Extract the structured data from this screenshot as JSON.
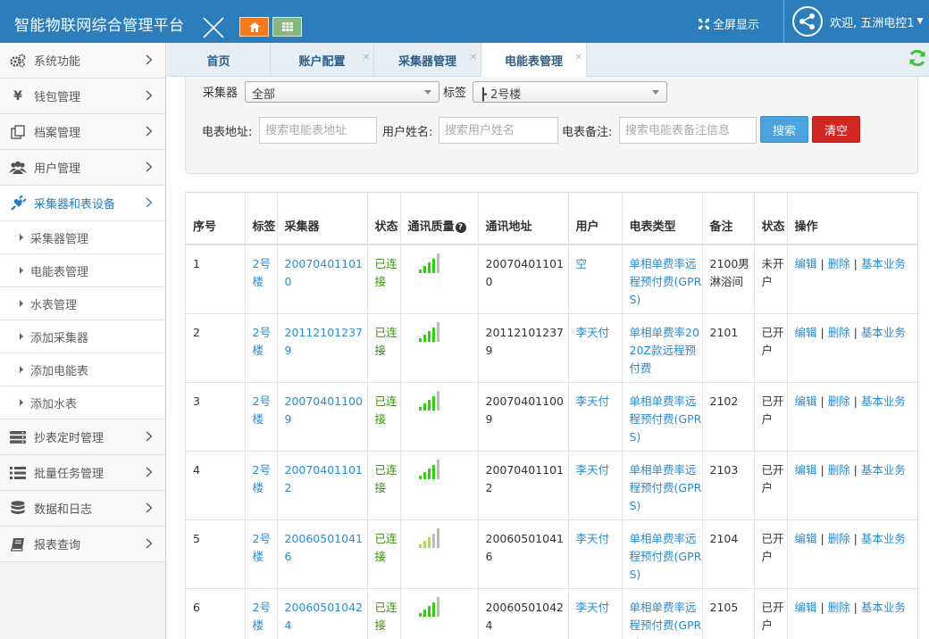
{
  "header": {
    "title": "智能物联网综合管理平台",
    "fullscreen": "全屏显示",
    "welcome": "欢迎, 五洲电控1"
  },
  "sidebar": {
    "items": [
      {
        "label": "系统功能",
        "icon": "cogs-icon"
      },
      {
        "label": "钱包管理",
        "icon": "yen-icon"
      },
      {
        "label": "档案管理",
        "icon": "archive-icon"
      },
      {
        "label": "用户管理",
        "icon": "users-icon"
      },
      {
        "label": "采集器和表设备",
        "icon": "plug-icon"
      }
    ],
    "subitems": [
      "采集器管理",
      "电能表管理",
      "水表管理",
      "添加采集器",
      "添加电能表",
      "添加水表"
    ],
    "items_after": [
      {
        "label": "抄表定时管理",
        "icon": "timer-icon"
      },
      {
        "label": "批量任务管理",
        "icon": "list-icon"
      },
      {
        "label": "数据和日志",
        "icon": "database-icon"
      },
      {
        "label": "报表查询",
        "icon": "book-icon"
      }
    ]
  },
  "tabs": [
    {
      "label": "首页"
    },
    {
      "label": "账户配置"
    },
    {
      "label": "采集器管理"
    },
    {
      "label": "电能表管理"
    }
  ],
  "filter": {
    "collector_label": "采集器",
    "collector_value": "全部",
    "tag_label": "标签",
    "tag_value": "┣ 2号楼",
    "meter_addr_label": "电表地址:",
    "meter_addr_placeholder": "搜索电能表地址",
    "user_label": "用户姓名:",
    "user_placeholder": "搜索用户姓名",
    "note_label": "电表备注:",
    "note_placeholder": "搜索电能表备注信息",
    "search": "搜索",
    "clear": "清空"
  },
  "table": {
    "headers": [
      "序号",
      "标签",
      "采集器",
      "状态",
      "通讯质量",
      "通讯地址",
      "用户",
      "电表类型",
      "备注",
      "状态",
      "操作"
    ],
    "rows": [
      {
        "no": "1",
        "tag": "2号楼",
        "collector": "200704011010",
        "status": "已连接",
        "signal": 4,
        "addr": "200704011010",
        "user": "空",
        "type": "单相单费率远程预付费(GPRS)",
        "note": "2100男淋浴间",
        "state": "未开户"
      },
      {
        "no": "2",
        "tag": "2号楼",
        "collector": "201121012379",
        "status": "已连接",
        "signal": 4,
        "addr": "201121012379",
        "user": "李天付",
        "type": "单相单费率2020Z款远程预付费",
        "note": "2101",
        "state": "已开户"
      },
      {
        "no": "3",
        "tag": "2号楼",
        "collector": "200704011009",
        "status": "已连接",
        "signal": 4,
        "addr": "200704011009",
        "user": "李天付",
        "type": "单相单费率远程预付费(GPRS)",
        "note": "2102",
        "state": "已开户"
      },
      {
        "no": "4",
        "tag": "2号楼",
        "collector": "200704011012",
        "status": "已连接",
        "signal": 4,
        "addr": "200704011012",
        "user": "李天付",
        "type": "单相单费率远程预付费(GPRS)",
        "note": "2103",
        "state": "已开户"
      },
      {
        "no": "5",
        "tag": "2号楼",
        "collector": "200605010416",
        "status": "已连接",
        "signal": 3,
        "addr": "200605010416",
        "user": "李天付",
        "type": "单相单费率远程预付费(GPRS)",
        "note": "2104",
        "state": "已开户"
      },
      {
        "no": "6",
        "tag": "2号楼",
        "collector": "200605010424",
        "status": "已连接",
        "signal": 4,
        "addr": "200605010424",
        "user": "李天付",
        "type": "单相单费率远程预付费(GPRS)",
        "note": "2105",
        "state": "已开户"
      }
    ],
    "actions": {
      "edit": "编辑",
      "delete": "删除",
      "basic": "基本业务"
    }
  }
}
